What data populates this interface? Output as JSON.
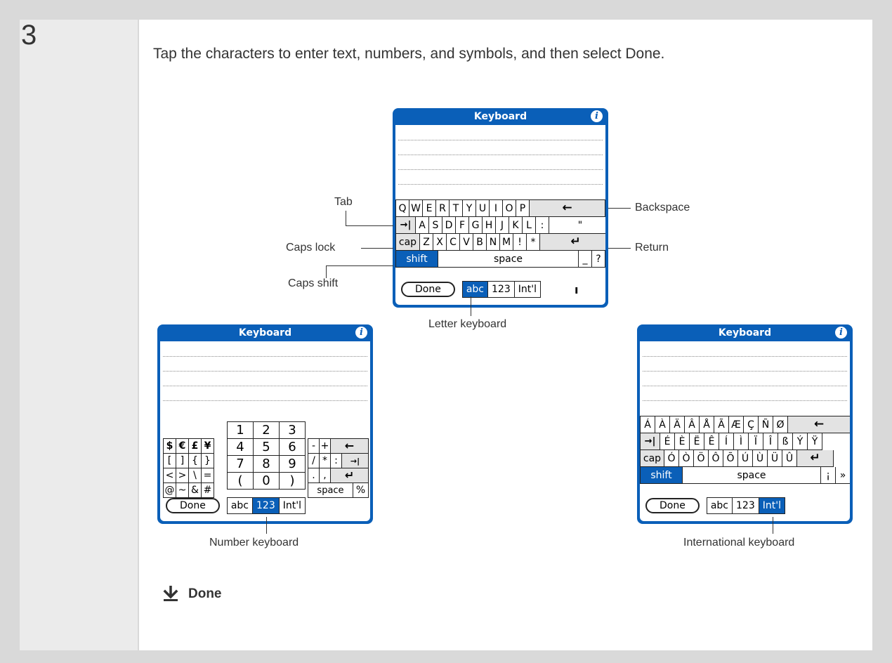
{
  "step": {
    "number": "3"
  },
  "instruction": "Tap the characters to enter text, numbers, and symbols, and then select Done.",
  "keyboard_title": "Keyboard",
  "info_glyph": "i",
  "done_label": "Done",
  "modes": [
    "abc",
    "123",
    "Int'l"
  ],
  "letter_keyboard": {
    "rows": [
      [
        "Q",
        "W",
        "E",
        "R",
        "T",
        "Y",
        "U",
        "I",
        "O",
        "P",
        "←"
      ],
      [
        "→|",
        "A",
        "S",
        "D",
        "F",
        "G",
        "H",
        "J",
        "K",
        "L",
        ":",
        "\""
      ],
      [
        "cap",
        "Z",
        "X",
        "C",
        "V",
        "B",
        "N",
        "M",
        "!",
        "*",
        "↵"
      ],
      [
        "shift",
        "space",
        "_",
        "?"
      ]
    ],
    "cursor": "ı"
  },
  "number_keyboard": {
    "left": [
      [
        "$",
        "€",
        "£",
        "¥"
      ],
      [
        "[",
        "]",
        "{",
        "}"
      ],
      [
        "<",
        ">",
        "\\",
        "="
      ],
      [
        "@",
        "~",
        "&",
        "#"
      ]
    ],
    "middle": [
      [
        "1",
        "2",
        "3"
      ],
      [
        "4",
        "5",
        "6"
      ],
      [
        "7",
        "8",
        "9"
      ],
      [
        "(",
        "0",
        ")"
      ]
    ],
    "right": [
      [
        "-",
        "+",
        "←"
      ],
      [
        "/",
        "*",
        ":",
        "→|"
      ],
      [
        ".",
        ",",
        "↵"
      ],
      [
        "space",
        "%"
      ]
    ]
  },
  "intl_keyboard": {
    "rows": [
      [
        "Á",
        "À",
        "Ä",
        "Â",
        "Å",
        "Ã",
        "Æ",
        "Ç",
        "Ñ",
        "Ø",
        "←"
      ],
      [
        "→|",
        "É",
        "È",
        "Ë",
        "Ê",
        "Í",
        "Ì",
        "Ï",
        "Î",
        "ß",
        "Ý",
        "Ÿ"
      ],
      [
        "cap",
        "Ó",
        "Ò",
        "Ö",
        "Ô",
        "Õ",
        "Ú",
        "Ù",
        "Ü",
        "Û",
        "↵"
      ],
      [
        "shift",
        "space",
        "¡",
        "»"
      ]
    ]
  },
  "callouts": {
    "tab": "Tab",
    "caps_lock": "Caps lock",
    "caps_shift": "Caps shift",
    "backspace": "Backspace",
    "return": "Return",
    "letter_keyboard": "Letter keyboard",
    "number_keyboard": "Number keyboard",
    "international_keyboard": "International keyboard"
  },
  "footer": {
    "done": "Done"
  },
  "colors": {
    "device_blue": "#0a5fb8",
    "highlight": "#0a5fb8",
    "text": "#333333"
  }
}
